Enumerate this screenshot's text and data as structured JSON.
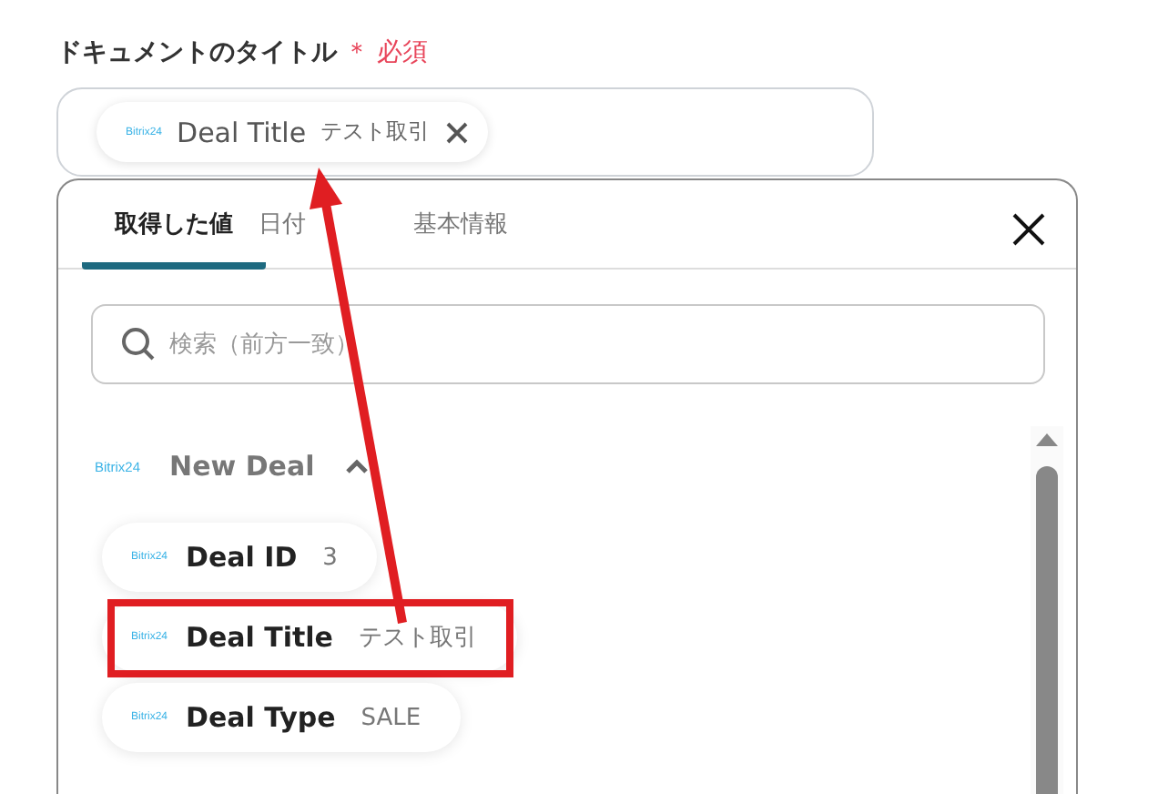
{
  "field": {
    "label": "ドキュメントのタイトル",
    "required_mark": "＊",
    "required": "必須",
    "chip": {
      "logo": "Bitrix24",
      "name": "Deal Title",
      "value": "テスト取引"
    }
  },
  "picker": {
    "tabs": [
      {
        "label": "取得した値",
        "selected": true
      },
      {
        "label": "日付",
        "selected": false
      },
      {
        "label": "基本情報",
        "selected": false
      }
    ],
    "search": {
      "placeholder": "検索（前方一致）"
    },
    "group": {
      "logo": "Bitrix24",
      "title": "New Deal",
      "expanded": true
    },
    "items": [
      {
        "logo": "Bitrix24",
        "name": "Deal ID",
        "value": "3",
        "highlighted": false
      },
      {
        "logo": "Bitrix24",
        "name": "Deal Title",
        "value": "テスト取引",
        "highlighted": true
      },
      {
        "logo": "Bitrix24",
        "name": "Deal Type",
        "value": "SALE",
        "highlighted": false
      }
    ]
  }
}
